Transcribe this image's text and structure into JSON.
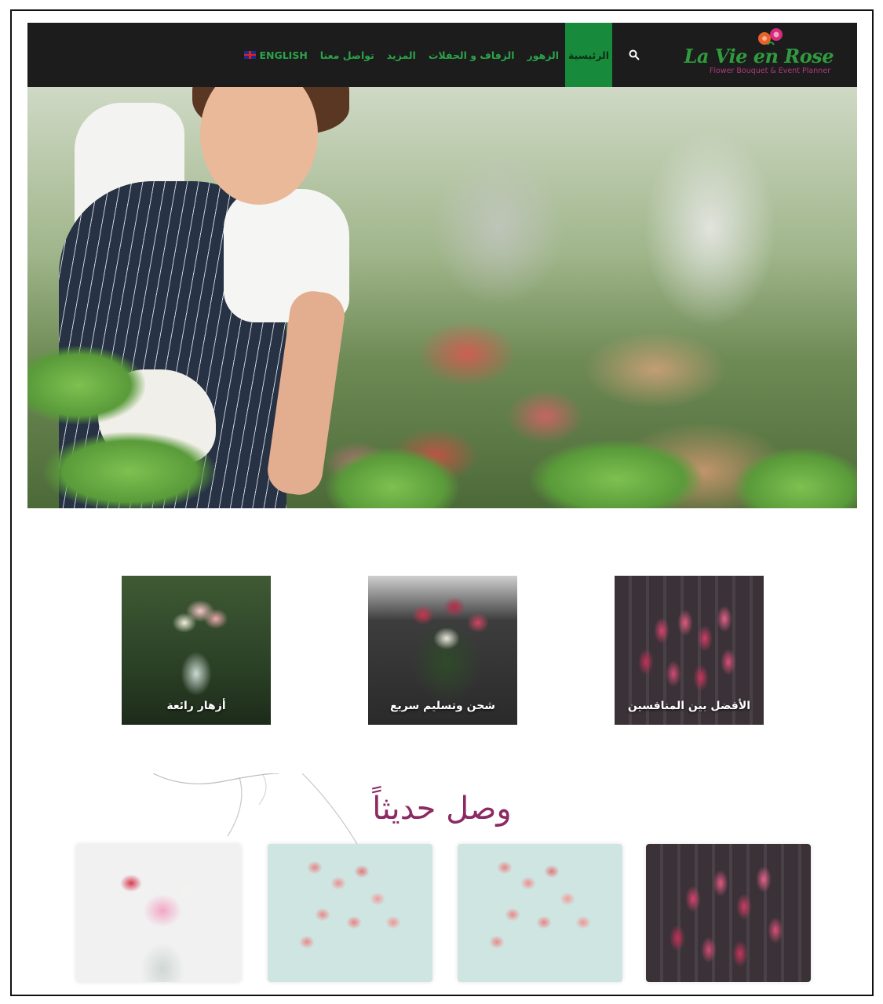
{
  "nav": {
    "logo": {
      "title": "La Vie en Rose",
      "subtitle": "Flower Bouquet & Event Planner"
    },
    "search_icon": "search-icon",
    "items": [
      {
        "label": "الرئيسية",
        "active": true
      },
      {
        "label": "الزهور"
      },
      {
        "label": "الزفاف و الحفلات"
      },
      {
        "label": "المزيد"
      },
      {
        "label": "تواصل معنا"
      },
      {
        "label": "ENGLISH",
        "icon": "uk-flag-icon"
      }
    ]
  },
  "features": [
    {
      "label": "الأفضل بين المنافسين"
    },
    {
      "label": "شحن وتسليم سريع"
    },
    {
      "label": "أزهار رائعة"
    }
  ],
  "recent": {
    "title": "وصل حديثاً"
  },
  "colors": {
    "nav_bg": "#1c1c1c",
    "accent_green": "#2aa34a",
    "active_green": "#178a3c",
    "brand_magenta": "#8b2a63"
  }
}
